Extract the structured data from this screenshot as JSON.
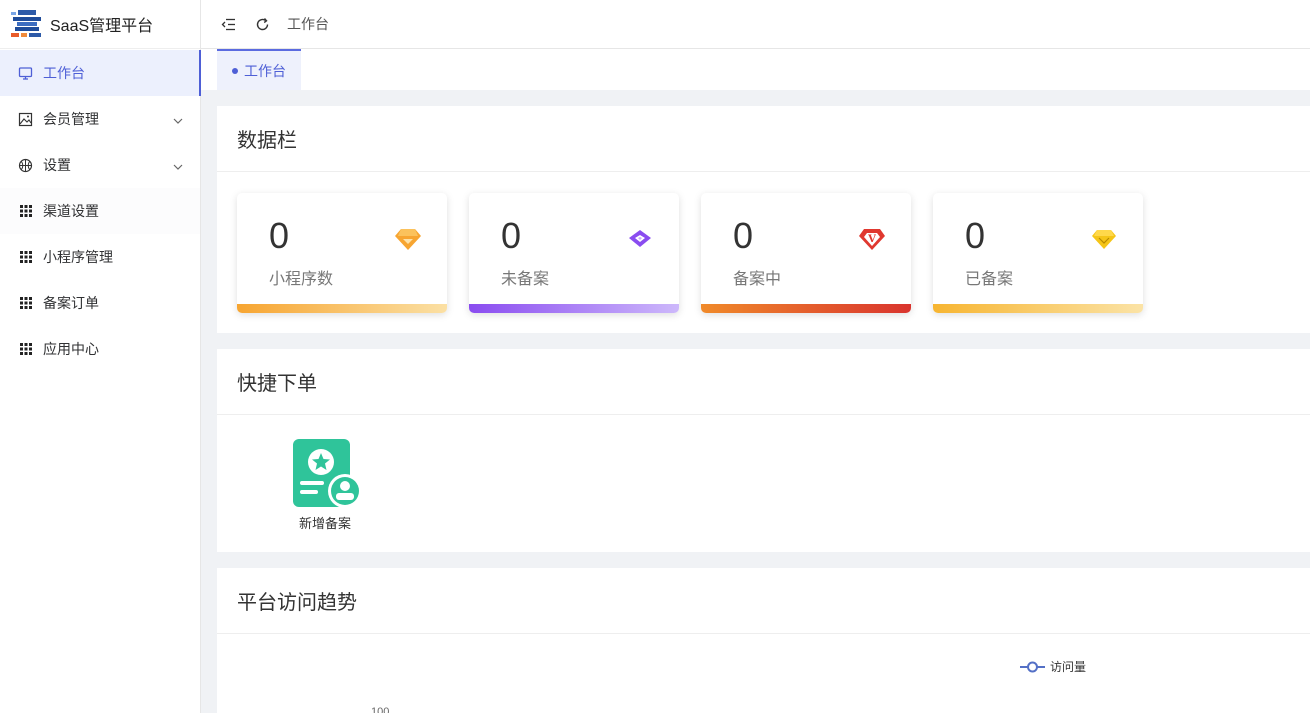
{
  "app": {
    "title": "SaaS管理平台"
  },
  "sidebar": {
    "items": [
      {
        "label": "工作台",
        "icon": "monitor-icon"
      },
      {
        "label": "会员管理",
        "icon": "image-icon"
      },
      {
        "label": "设置",
        "icon": "basketball-icon"
      },
      {
        "label": "渠道设置",
        "icon": "grid-icon"
      },
      {
        "label": "小程序管理",
        "icon": "grid-icon"
      },
      {
        "label": "备案订单",
        "icon": "grid-icon"
      },
      {
        "label": "应用中心",
        "icon": "grid-icon"
      }
    ]
  },
  "header": {
    "breadcrumb": "工作台"
  },
  "tabs": [
    {
      "label": "工作台"
    }
  ],
  "data_panel": {
    "title": "数据栏",
    "cards": [
      {
        "value": "0",
        "label": "小程序数",
        "icon": "orange-diamond-icon",
        "color": "#f7a531"
      },
      {
        "value": "0",
        "label": "未备案",
        "icon": "purple-diamond-icon",
        "color": "#8a4cf0"
      },
      {
        "value": "0",
        "label": "备案中",
        "icon": "red-vip-icon",
        "color": "#e0382f"
      },
      {
        "value": "0",
        "label": "已备案",
        "icon": "yellow-diamond-icon",
        "color": "#f5c518"
      }
    ]
  },
  "quick_panel": {
    "title": "快捷下单",
    "items": [
      {
        "label": "新增备案",
        "icon": "certificate-icon"
      }
    ]
  },
  "trend_panel": {
    "title": "平台访问趋势",
    "legend": "访问量",
    "y_tick": "100"
  },
  "colors": {
    "accent": "#4e5fd6",
    "quick_green": "#2fc49a"
  }
}
